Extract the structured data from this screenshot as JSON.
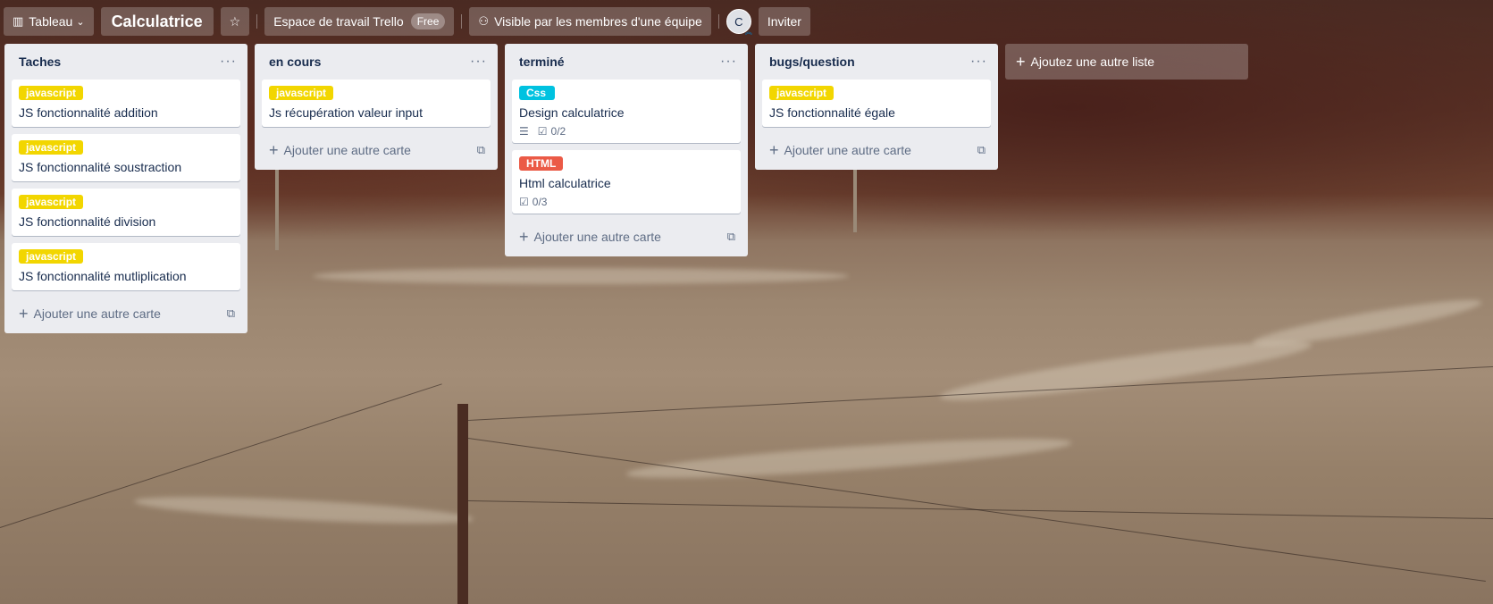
{
  "header": {
    "board_switcher_label": "Tableau",
    "board_title": "Calculatrice",
    "workspace_label": "Espace de travail Trello",
    "workspace_badge": "Free",
    "visibility_label": "Visible par les membres d'une équipe",
    "avatar_initial": "C",
    "invite_label": "Inviter"
  },
  "colors": {
    "label_yellow": "#f2d600",
    "label_sky": "#00c2e0",
    "label_red": "#eb5a46",
    "list_bg": "#ebecf0"
  },
  "lists": [
    {
      "title": "Taches",
      "cards": [
        {
          "label": "javascript",
          "label_color": "yellow",
          "title": "JS fonctionnalité addition"
        },
        {
          "label": "javascript",
          "label_color": "yellow",
          "title": "JS fonctionnalité soustraction"
        },
        {
          "label": "javascript",
          "label_color": "yellow",
          "title": "JS fonctionnalité division"
        },
        {
          "label": "javascript",
          "label_color": "yellow",
          "title": "JS fonctionnalité mutliplication"
        }
      ],
      "add_card_label": "Ajouter une autre carte"
    },
    {
      "title": "en cours",
      "cards": [
        {
          "label": "javascript",
          "label_color": "yellow",
          "title": "Js récupération valeur input"
        }
      ],
      "add_card_label": "Ajouter une autre carte"
    },
    {
      "title": "terminé",
      "cards": [
        {
          "label": "Css",
          "label_color": "sky",
          "title": "Design calculatrice",
          "has_description": true,
          "checklist": "0/2"
        },
        {
          "label": "HTML",
          "label_color": "red",
          "title": "Html calculatrice",
          "checklist": "0/3"
        }
      ],
      "add_card_label": "Ajouter une autre carte"
    },
    {
      "title": "bugs/question",
      "cards": [
        {
          "label": "javascript",
          "label_color": "yellow",
          "title": "JS fonctionnalité égale"
        }
      ],
      "add_card_label": "Ajouter une autre carte"
    }
  ],
  "add_list_label": "Ajoutez une autre liste"
}
